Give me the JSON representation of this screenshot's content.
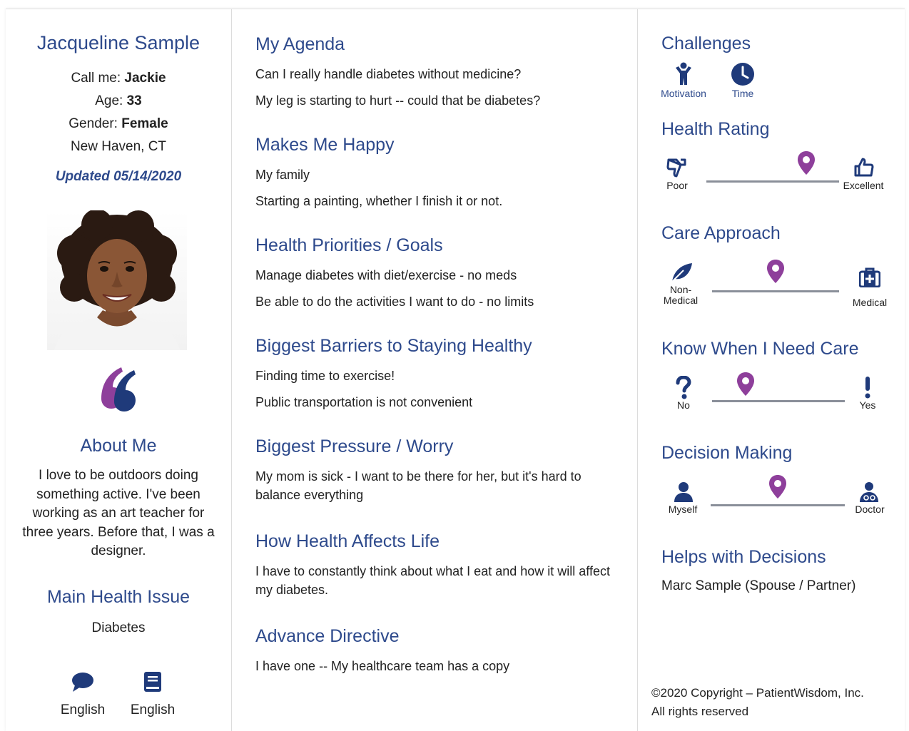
{
  "profile": {
    "name": "Jacqueline Sample",
    "call_me_label": "Call me:",
    "call_me_value": "Jackie",
    "age_label": "Age:",
    "age_value": "33",
    "gender_label": "Gender:",
    "gender_value": "Female",
    "location": "New Haven, CT",
    "updated": "Updated 05/14/2020"
  },
  "about": {
    "heading": "About Me",
    "text": "I love to be outdoors doing something active. I've been working as an art teacher for three years. Before that, I was a designer."
  },
  "main_issue": {
    "heading": "Main Health Issue",
    "value": "Diabetes"
  },
  "languages": {
    "spoken": "English",
    "written": "English"
  },
  "sections": {
    "agenda": {
      "heading": "My Agenda",
      "lines": [
        "Can I really handle diabetes without medicine?",
        "My leg is starting to hurt -- could that be diabetes?"
      ]
    },
    "happy": {
      "heading": "Makes Me Happy",
      "lines": [
        "My family",
        "Starting a painting, whether I finish it or not."
      ]
    },
    "priorities": {
      "heading": "Health Priorities / Goals",
      "lines": [
        "Manage diabetes with diet/exercise - no meds",
        "Be able to do the activities I want to do - no limits"
      ]
    },
    "barriers": {
      "heading": "Biggest Barriers to Staying Healthy",
      "lines": [
        "Finding time to exercise!",
        "Public transportation is not convenient"
      ]
    },
    "pressure": {
      "heading": "Biggest Pressure / Worry",
      "text": "My mom is sick - I want to be there for her, but it's hard to balance everything"
    },
    "affects": {
      "heading": "How Health Affects Life",
      "text": "I have to constantly think about what I eat and how it will affect my diabetes."
    },
    "directive": {
      "heading": "Advance Directive",
      "lines": [
        "I have one -- My healthcare team has a copy"
      ]
    }
  },
  "challenges": {
    "heading": "Challenges",
    "items": [
      {
        "label": "Motivation",
        "icon": "person-raised-arms-icon"
      },
      {
        "label": "Time",
        "icon": "clock-icon"
      }
    ]
  },
  "scales": {
    "health_rating": {
      "heading": "Health Rating",
      "low": "Poor",
      "high": "Excellent",
      "position": 0.75
    },
    "care_approach": {
      "heading": "Care Approach",
      "low": "Non-Medical",
      "high": "Medical",
      "position": 0.5
    },
    "know_care": {
      "heading": "Know When I Need Care",
      "low": "No",
      "high": "Yes",
      "position": 0.25
    },
    "decision": {
      "heading": "Decision Making",
      "low": "Myself",
      "high": "Doctor",
      "position": 0.5
    }
  },
  "helps": {
    "heading": "Helps with Decisions",
    "value": "Marc Sample (Spouse / Partner)"
  },
  "footer": {
    "copyright": "©2020 Copyright – PatientWisdom, Inc.",
    "rights": "All rights reserved"
  },
  "colors": {
    "heading_blue": "#2e4a8c",
    "icon_navy": "#1f3a7a",
    "pin_purple": "#8e3f9b",
    "track_gray": "#8a8f99"
  }
}
